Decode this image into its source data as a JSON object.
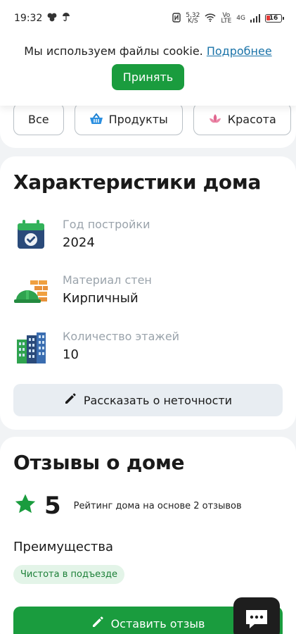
{
  "status_bar": {
    "time": "19:32",
    "speed": "5,32\nK/S",
    "network": "4G",
    "volte": "Vo\nLTE",
    "battery": "16"
  },
  "cookie": {
    "text": "Мы используем файлы cookie.",
    "link": "Подробнее",
    "accept": "Принять"
  },
  "categories": [
    {
      "label": "Все",
      "icon": ""
    },
    {
      "label": "Продукты",
      "icon": "basket-icon"
    },
    {
      "label": "Красота",
      "icon": "lotus-icon"
    }
  ],
  "house": {
    "title": "Характеристики дома",
    "features": [
      {
        "label": "Год постройки",
        "value": "2024",
        "icon": "calendar-check-icon"
      },
      {
        "label": "Материал стен",
        "value": "Кирпичный",
        "icon": "helmet-bricks-icon"
      },
      {
        "label": "Количество этажей",
        "value": "10",
        "icon": "buildings-icon"
      }
    ],
    "report_label": "Рассказать о неточности"
  },
  "reviews": {
    "title": "Отзывы о доме",
    "rating": "5",
    "rating_desc": "Рейтинг дома на основе 2 отзывов",
    "advantages_title": "Преимущества",
    "advantage_tag": "Чистота в подъезде",
    "leave_review_label": "Оставить отзыв"
  },
  "colors": {
    "accent": "#1a9c3e",
    "link": "#1a73a8",
    "muted": "#9aa3ab",
    "tag_bg": "#e3f4e8"
  }
}
